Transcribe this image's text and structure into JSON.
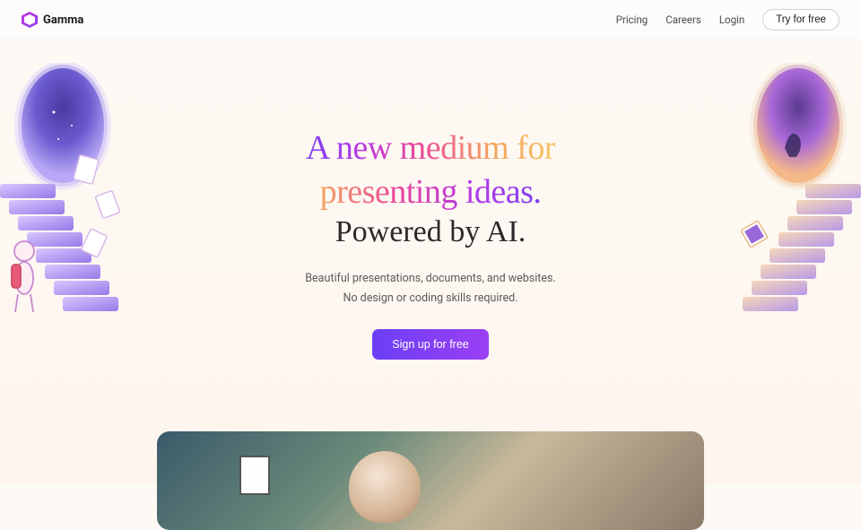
{
  "brand": {
    "name": "Gamma"
  },
  "nav": {
    "pricing": "Pricing",
    "careers": "Careers",
    "login": "Login",
    "try": "Try for free"
  },
  "hero": {
    "line1": "A new medium for",
    "line2": "presenting ideas.",
    "powered": "Powered by AI.",
    "sub1": "Beautiful presentations, documents, and websites.",
    "sub2": "No design or coding skills required.",
    "cta": "Sign up for free"
  }
}
